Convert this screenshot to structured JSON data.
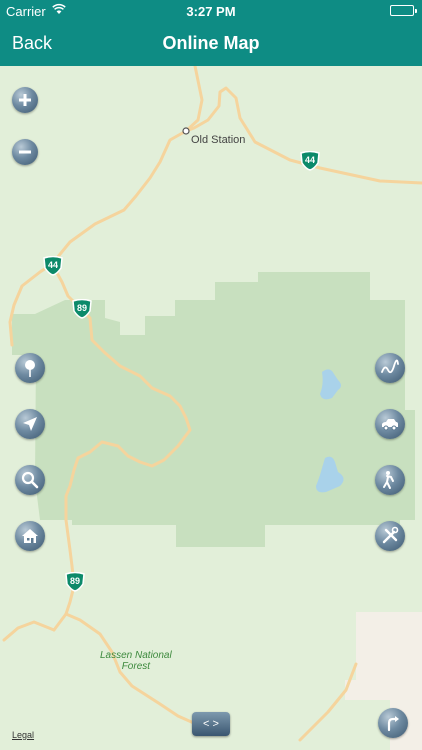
{
  "status_bar": {
    "carrier": "Carrier",
    "time": "3:27 PM"
  },
  "nav": {
    "back_label": "Back",
    "title": "Online Map"
  },
  "map": {
    "places": [
      {
        "name": "Old Station"
      }
    ],
    "forest": "Lassen National\nForest",
    "highway_shields": [
      "44",
      "44",
      "89",
      "89"
    ],
    "legal": "Legal",
    "pager": "< >"
  },
  "controls": {
    "left": [
      "zoom-in",
      "zoom-out",
      "pin",
      "locate",
      "search",
      "home"
    ],
    "right": [
      "route",
      "car",
      "pedestrian",
      "tools",
      "directions"
    ]
  }
}
